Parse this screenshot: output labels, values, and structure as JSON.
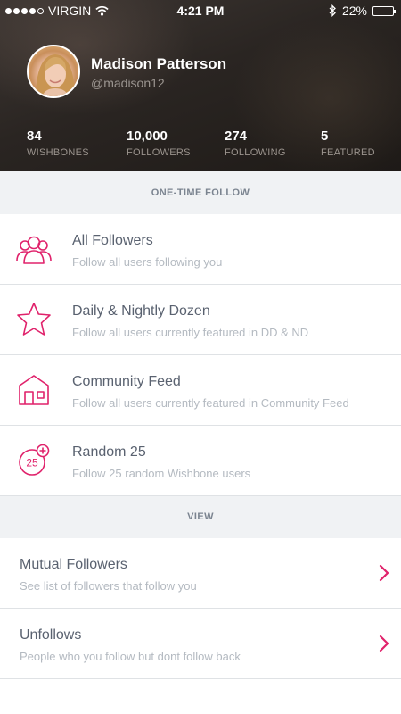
{
  "status_bar": {
    "carrier": "VIRGIN",
    "time": "4:21 PM",
    "battery": "22%",
    "battery_level": 0.22,
    "signal_bars": 4,
    "icons": [
      "signal-dots-icon",
      "wifi-icon",
      "bluetooth-icon",
      "battery-icon"
    ]
  },
  "profile": {
    "name": "Madison Patterson",
    "handle": "@madison12"
  },
  "stats": [
    {
      "value": "84",
      "label": "WISHBONES"
    },
    {
      "value": "10,000",
      "label": "FOLLOWERS"
    },
    {
      "value": "274",
      "label": "FOLLOWING"
    },
    {
      "value": "5",
      "label": "FEATURED"
    }
  ],
  "sections": {
    "one_time_follow": "ONE-TIME FOLLOW",
    "view": "VIEW"
  },
  "follow_options": [
    {
      "icon": "users-icon",
      "title": "All Followers",
      "subtitle": "Follow all users following you"
    },
    {
      "icon": "star-icon",
      "title": "Daily & Nightly Dozen",
      "subtitle": "Follow all users currently featured in DD & ND"
    },
    {
      "icon": "home-icon",
      "title": "Community Feed",
      "subtitle": "Follow all users currently featured in Community Feed"
    },
    {
      "icon": "random-25-icon",
      "icon_text": "25",
      "title": "Random 25",
      "subtitle": "Follow 25 random Wishbone users"
    }
  ],
  "view_options": [
    {
      "title": "Mutual Followers",
      "subtitle": "See list of followers that follow you",
      "icon": "chevron-right-icon"
    },
    {
      "title": "Unfollows",
      "subtitle": "People who you follow but dont follow back",
      "icon": "chevron-right-icon"
    }
  ],
  "colors": {
    "accent": "#e0226b",
    "section_bg": "#f0f2f4",
    "title_text": "#5a6270",
    "subtitle_text": "#b4bac1"
  }
}
